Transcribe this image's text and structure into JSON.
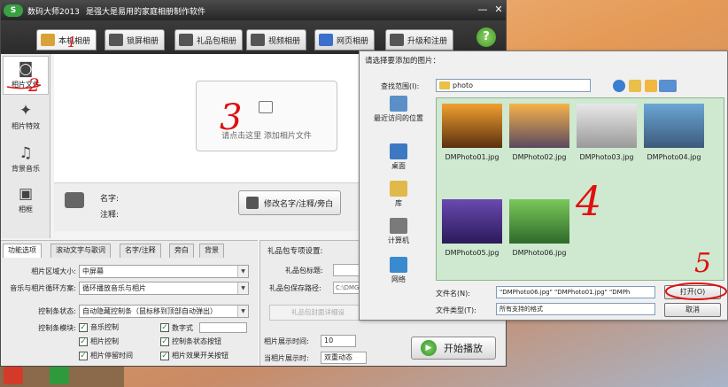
{
  "window": {
    "logo_text": "S",
    "app_name": "数码大师2013",
    "tagline": "是强大是易用的家庭相册制作软件",
    "minimize": "—",
    "close": "✕"
  },
  "tabs": [
    {
      "label": "本机相册",
      "icon": "photo-album-icon",
      "color": "#d9a238",
      "active": true
    },
    {
      "label": "锁屏相册",
      "icon": "monitor-icon",
      "color": "#555555",
      "active": false
    },
    {
      "label": "礼品包相册",
      "icon": "gift-icon",
      "color": "#555555",
      "active": false
    },
    {
      "label": "视频相册",
      "icon": "film-icon",
      "color": "#555555",
      "active": false
    },
    {
      "label": "网页相册",
      "icon": "ie-icon",
      "color": "#3b6fc9",
      "active": false
    },
    {
      "label": "升级和注册",
      "icon": "upgrade-icon",
      "color": "#555555",
      "active": false
    }
  ],
  "help": "?",
  "sidebar": [
    {
      "label": "相片文件",
      "icon": "camera-icon",
      "glyph": "◙",
      "active": true
    },
    {
      "label": "相片特效",
      "icon": "effects-icon",
      "glyph": "✦",
      "active": false
    },
    {
      "label": "背景音乐",
      "icon": "music-icon",
      "glyph": "♫",
      "active": false
    },
    {
      "label": "相框",
      "icon": "frame-icon",
      "glyph": "▣",
      "active": false
    }
  ],
  "upload": {
    "text": "请点击这里  添加相片文件"
  },
  "info": {
    "name_label": "名字:",
    "note_label": "注释:",
    "edit_button": "修改名字/注释/旁白"
  },
  "settings": {
    "tabs": [
      "功能选项",
      "滚动文字与歌词",
      "名字/注释",
      "旁白",
      "背景"
    ],
    "region_label": "相片区域大小:",
    "region_value": "中屏幕",
    "loop_label": "音乐与相片循环方案:",
    "loop_value": "循环播放音乐与相片",
    "controlbar_label": "控制条状态:",
    "controlbar_value": "自动隐藏控制条（鼠标移到顶部自动弹出）",
    "module_label": "控制条模块:",
    "checks": [
      "音乐控制",
      "数字式",
      "相片控制",
      "控制条状态按钮",
      "相片停留时间",
      "相片效果开关按钮"
    ],
    "check_mark": "✓"
  },
  "gift": {
    "title": "礼品包专项设置:",
    "title_label": "礼品包标题:",
    "path_label": "礼品包保存路径:",
    "path_value": "C:\\DMG",
    "detail_button": "礼品包封面详细设",
    "display_time_label": "相片展示时间:",
    "display_time_value": "10",
    "mode_label": "当相片展示时:",
    "mode_value": "双重动态",
    "play_button": "开始播放",
    "play_glyph": "▶"
  },
  "dialog": {
    "title": "请选择要添加的图片：",
    "lookin_label": "查找范围(I):",
    "lookin_value": "photo",
    "places": [
      {
        "label": "最近访问的位置",
        "icon": "recent-places-icon",
        "color": "#5a8fc8"
      },
      {
        "label": "桌面",
        "icon": "desktop-icon",
        "color": "#3d78c2"
      },
      {
        "label": "库",
        "icon": "library-icon",
        "color": "#e0b94a"
      },
      {
        "label": "计算机",
        "icon": "computer-icon",
        "color": "#7a7a7a"
      },
      {
        "label": "网络",
        "icon": "network-icon",
        "color": "#3a8ad0"
      }
    ],
    "files": [
      {
        "name": "DMPhoto01.jpg",
        "colors": [
          "#f0a030",
          "#5a3010"
        ]
      },
      {
        "name": "DMPhoto02.jpg",
        "colors": [
          "#f6b24a",
          "#5a4a60"
        ]
      },
      {
        "name": "DMPhoto03.jpg",
        "colors": [
          "#e8e8e8",
          "#9a9a9a"
        ]
      },
      {
        "name": "DMPhoto04.jpg",
        "colors": [
          "#6aa6d6",
          "#3d5a7a"
        ]
      },
      {
        "name": "DMPhoto05.jpg",
        "colors": [
          "#6a4ab0",
          "#2a1a5a"
        ]
      },
      {
        "name": "DMPhoto06.jpg",
        "colors": [
          "#7ac85a",
          "#2f6a2a"
        ]
      }
    ],
    "filename_label": "文件名(N):",
    "filename_value": "\"DMPhoto06.jpg\" \"DMPhoto01.jpg\" \"DMPh",
    "filetype_label": "文件类型(T):",
    "filetype_value": "所有支持的格式",
    "open_button": "打开(O)",
    "cancel_button": "取消"
  },
  "annotations": [
    "1",
    "2",
    "3",
    "4",
    "5"
  ]
}
